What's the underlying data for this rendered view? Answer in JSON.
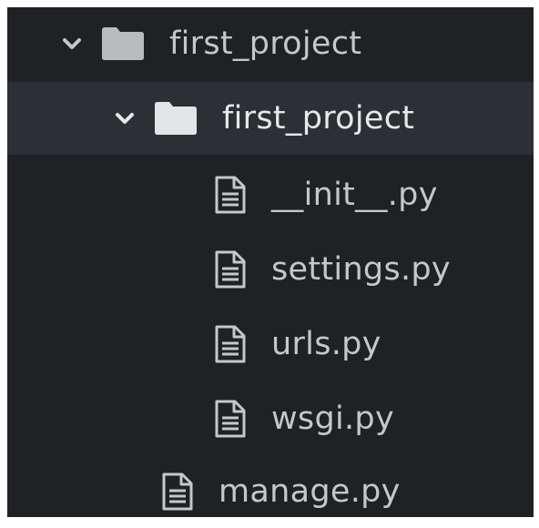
{
  "tree": {
    "root_folder": {
      "label": "first_project",
      "icon": "folder-icon",
      "expanded": true
    },
    "sub_folder": {
      "label": "first_project",
      "icon": "folder-icon",
      "expanded": true,
      "selected": true
    },
    "files": [
      {
        "label": "__init__.py",
        "icon": "file-icon"
      },
      {
        "label": "settings.py",
        "icon": "file-icon"
      },
      {
        "label": "urls.py",
        "icon": "file-icon"
      },
      {
        "label": "wsgi.py",
        "icon": "file-icon"
      }
    ],
    "root_files": [
      {
        "label": "manage.py",
        "icon": "file-icon"
      }
    ]
  },
  "colors": {
    "panel_bg": "#1f2124",
    "selected_bg": "#2c2f33",
    "text": "#c4c8cc",
    "folder_icon": "#b9bcbf",
    "folder_icon_selected": "#e3e5e7"
  }
}
